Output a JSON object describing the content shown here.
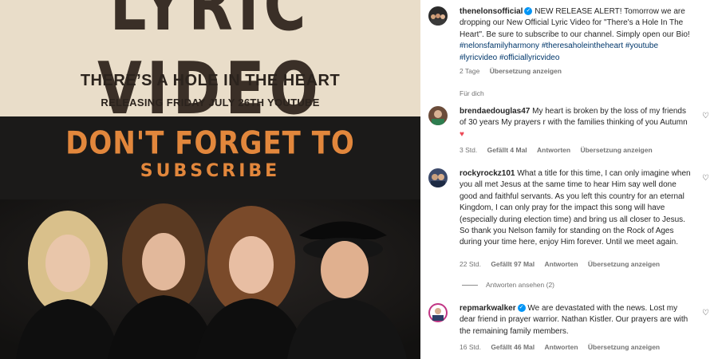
{
  "media": {
    "big_title": "LYRIC VIDEO",
    "song_title": "THERE’S A HOLE IN THE HEART",
    "release_line": "RELEASING FRIDAY JULY 26TH YOUTUBE",
    "cta_line1": "DON'T FORGET TO",
    "cta_line2": "SUBSCRIBE",
    "colors": {
      "cream": "#e9ddc9",
      "orange": "#e2873c",
      "dark": "#1b1a19"
    }
  },
  "post": {
    "username": "thenelonsofficial",
    "caption": "NEW RELEASE ALERT! Tomorrow we are dropping our New Official Lyric Video for \"There's a Hole In The Heart\". Be sure to subscribe to our channel. Simply open our Bio!",
    "hashtags": "#nelonsfamilyharmony #theresaholeintheheart #youtube #lyricvideo #officiallyricvideo",
    "time": "2 Tage",
    "translate": "Übersetzung anzeigen"
  },
  "for_you": "Für dich",
  "comments": [
    {
      "username": "brendaedouglas47",
      "text": "My heart is broken by the loss of my friends of 30 years My prayers r with the families thinking of you Autumn",
      "time": "3 Std.",
      "likes": "Gefällt 4 Mal",
      "reply": "Antworten",
      "translate": "Übersetzung anzeigen"
    },
    {
      "username": "rockyrockz101",
      "text": "What a title for this time, I can only imagine when you all met Jesus at the same time to hear Him say well done good and faithful servants. As you left this country for an eternal Kingdom, I can only pray for the impact this song will have (especially during election time) and bring us all closer to Jesus. So thank you Nelson family for standing on the Rock of Ages during your time here, enjoy Him forever. Until we meet again.",
      "time": "22 Std.",
      "likes": "Gefällt 97 Mal",
      "reply": "Antworten",
      "translate": "Übersetzung anzeigen",
      "view_replies": "Antworten ansehen (2)"
    },
    {
      "username": "repmarkwalker",
      "text": "We are devastated with the news. Lost my dear friend in prayer warrior. Nathan Kistler. Our prayers are with the remaining family members.",
      "time": "16 Std.",
      "likes": "Gefällt 46 Mal",
      "reply": "Antworten",
      "translate": "Übersetzung anzeigen"
    }
  ]
}
